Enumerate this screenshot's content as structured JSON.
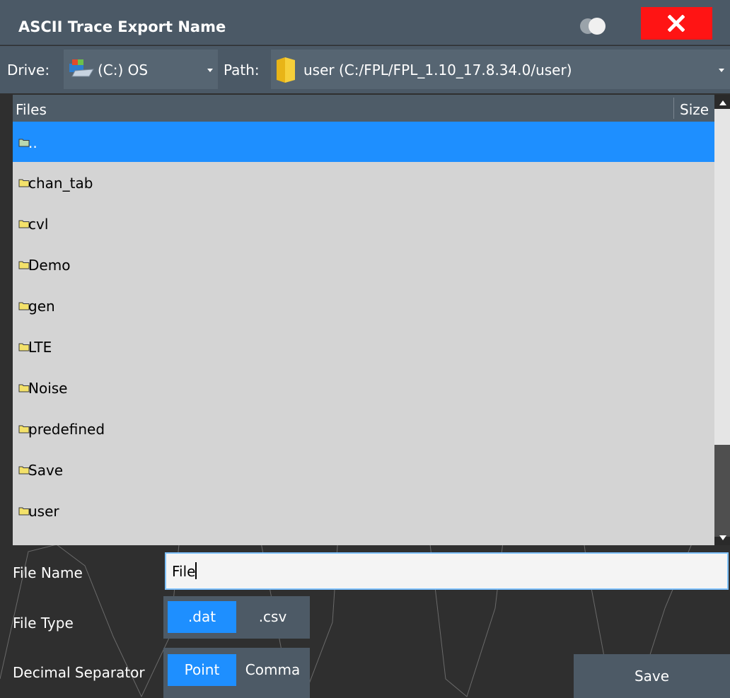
{
  "dialog": {
    "title": "ASCII Trace Export Name"
  },
  "icons": {
    "toggle": "toggle-icon",
    "close": "close-icon",
    "drive": "drive-icon",
    "folder": "folder-icon"
  },
  "colors": {
    "title_bar": "#4b5966",
    "close_button": "#ff1414",
    "selection": "#1e8fff",
    "list_background": "#d4d4d4"
  },
  "drive": {
    "label": "Drive:",
    "value": "(C:) OS"
  },
  "path": {
    "label": "Path:",
    "value": "user (C:/FPL/FPL_1.10_17.8.34.0/user)"
  },
  "file_list": {
    "columns": [
      "Files",
      "Size"
    ],
    "rows": [
      {
        "name": "..",
        "selected": true
      },
      {
        "name": "chan_tab"
      },
      {
        "name": "cvl"
      },
      {
        "name": "Demo"
      },
      {
        "name": "gen"
      },
      {
        "name": "LTE"
      },
      {
        "name": "Noise"
      },
      {
        "name": "predefined"
      },
      {
        "name": "Save"
      },
      {
        "name": "user"
      }
    ]
  },
  "file_name": {
    "label": "File Name",
    "value": "File"
  },
  "file_type": {
    "label": "File Type",
    "options": [
      ".dat",
      ".csv"
    ],
    "selected": ".dat"
  },
  "decimal_separator": {
    "label": "Decimal Separator",
    "options": [
      "Point",
      "Comma"
    ],
    "selected": "Point"
  },
  "actions": {
    "save_label": "Save"
  }
}
